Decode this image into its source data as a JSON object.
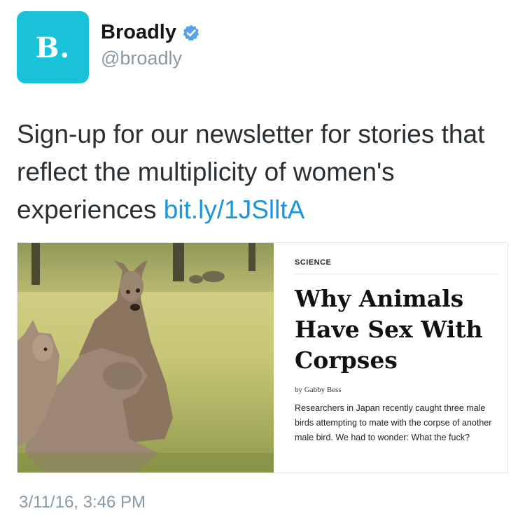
{
  "author": {
    "avatar_text": "B.",
    "avatar_color": "#19c2d9",
    "display_name": "Broadly",
    "handle": "@broadly",
    "verified_icon": "verified-badge-icon",
    "verified_color": "#5aa2e8"
  },
  "tweet": {
    "text": "Sign-up for our newsletter for stories that reflect the multiplicity of women's experiences ",
    "link_text": "bit.ly/1JSlltA",
    "link_color": "#1b95e0",
    "timestamp": "3/11/16, 3:46 PM"
  },
  "card": {
    "image": "kangaroo-photo",
    "section": "SCIENCE",
    "headline": "Why Animals Have Sex With Corpses",
    "byline": "by Gabby Bess",
    "summary": "Researchers in Japan recently caught three male birds attempting to mate with the corpse of another male bird. We had to wonder: What the fuck?"
  }
}
